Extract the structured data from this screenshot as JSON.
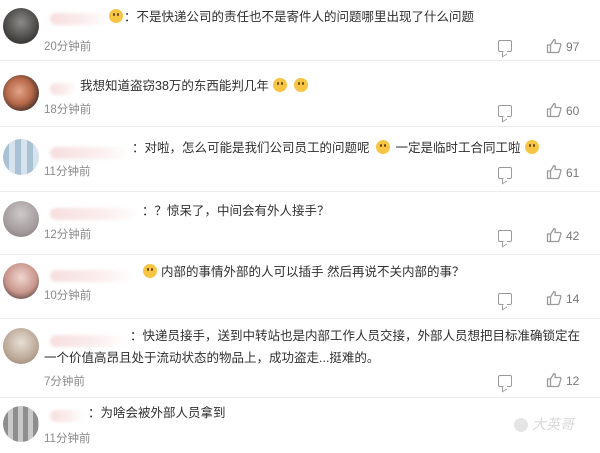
{
  "comments": [
    {
      "text": "：不是快递公司的责任也不是寄件人的问题哪里出现了什么问题",
      "time": "20分钟前",
      "likes": "97"
    },
    {
      "text": "我想知道盗窃38万的东西能判几年",
      "time": "18分钟前",
      "likes": "60"
    },
    {
      "text": "：对啦，怎么可能是我们公司员工的问题呢",
      "text2": "一定是临时工合同工啦",
      "time": "11分钟前",
      "likes": "61"
    },
    {
      "text": "：？惊呆了，中间会有外人接手？",
      "time": "12分钟前",
      "likes": "42"
    },
    {
      "text": "内部的事情外部的人可以插手 然后再说不关内部的事？",
      "time": "10分钟前",
      "likes": "14"
    },
    {
      "text": "：快递员接手，送到中转站也是内部工作人员交接，外部人员想把目标准确锁定在一个价值高昂且处于流动状态的物品上，成功盗走...挺难的。",
      "time": "7分钟前",
      "likes": "12"
    },
    {
      "text": "：为啥会被外部人员拿到",
      "time": "11分钟前",
      "likes": ""
    }
  ],
  "watermark": "大英哥",
  "colors": {
    "background": "#ffffff",
    "text": "#2f2f2f",
    "time": "#8a8a8a",
    "icon": "#9a9a9a"
  },
  "icons": [
    "reply-icon",
    "like-icon",
    "emoji-icon"
  ]
}
